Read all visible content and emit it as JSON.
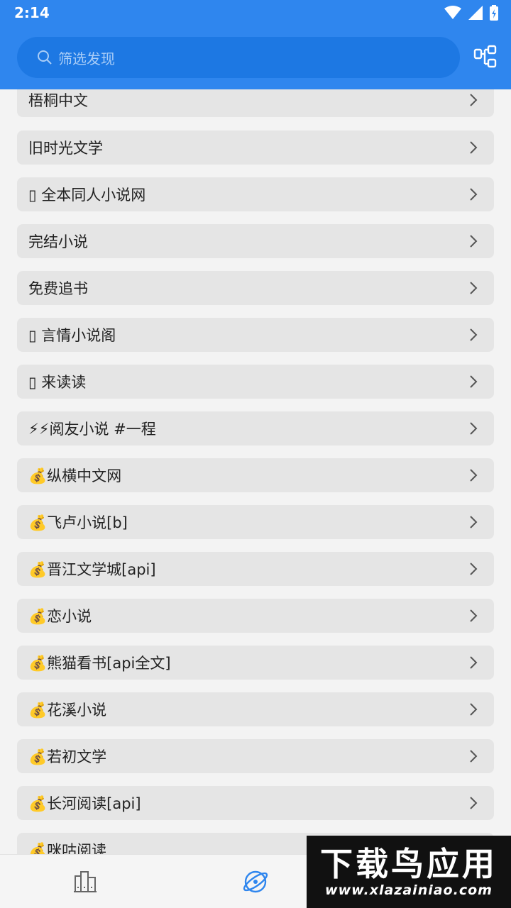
{
  "status_bar": {
    "time": "2:14"
  },
  "search": {
    "placeholder": "筛选发现"
  },
  "colors": {
    "primary": "#2f86ee",
    "row_bg": "#e5e5e5",
    "accent_icon": "#2f86ee"
  },
  "rows": [
    {
      "label": "梧桐中文"
    },
    {
      "label": "旧时光文学"
    },
    {
      "label": "▯ 全本同人小说网"
    },
    {
      "label": "完结小说"
    },
    {
      "label": "免费追书"
    },
    {
      "label": "▯ 言情小说阁"
    },
    {
      "label": "▯ 来读读"
    },
    {
      "label": "⚡⚡阅友小说 #一程"
    },
    {
      "label": "💰纵横中文网"
    },
    {
      "label": "💰飞卢小说[b]"
    },
    {
      "label": "💰晋江文学城[api]"
    },
    {
      "label": "💰恋小说"
    },
    {
      "label": "💰熊猫看书[api全文]"
    },
    {
      "label": "💰花溪小说"
    },
    {
      "label": "💰若初文学"
    },
    {
      "label": "💰长河阅读[api]"
    },
    {
      "label": "💰咪咕阅读"
    }
  ],
  "bottom_nav": [
    {
      "icon": "bookshelf-icon",
      "active": false
    },
    {
      "icon": "explore-icon",
      "active": true
    }
  ],
  "watermark": {
    "title": "下载鸟应用",
    "url": "www.xlazainiao.com"
  }
}
